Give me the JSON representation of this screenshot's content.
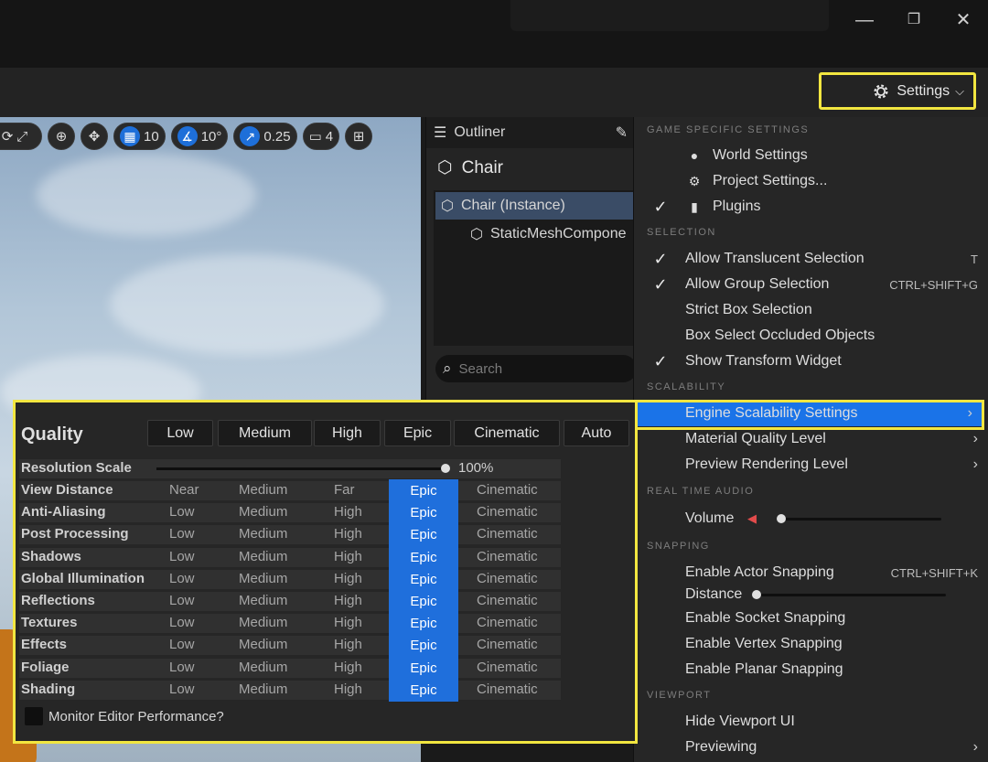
{
  "window": {
    "minimize": "—",
    "restore": "❐",
    "close": "✕"
  },
  "settings_button": {
    "label": "Settings",
    "icon": "gear-icon"
  },
  "viewport_toolbar": {
    "grid_value": "10",
    "angle_value": "10°",
    "scale_value": "0.25",
    "camera_value": "4"
  },
  "outliner": {
    "tab_label": "Outliner",
    "header": "Chair",
    "items": [
      {
        "label": "Chair (Instance)"
      },
      {
        "label": "StaticMeshCompone"
      }
    ],
    "search_placeholder": "Search"
  },
  "settings_menu": {
    "sections": {
      "game": "GAME SPECIFIC SETTINGS",
      "selection": "SELECTION",
      "scalability": "SCALABILITY",
      "audio": "REAL TIME AUDIO",
      "snapping": "SNAPPING",
      "viewport": "VIEWPORT"
    },
    "game": [
      {
        "label": "World Settings",
        "checked": false
      },
      {
        "label": "Project Settings...",
        "checked": false
      },
      {
        "label": "Plugins",
        "checked": true
      }
    ],
    "selection": [
      {
        "label": "Allow Translucent Selection",
        "checked": true,
        "shortcut": "T"
      },
      {
        "label": "Allow Group Selection",
        "checked": true,
        "shortcut": "CTRL+SHIFT+G"
      },
      {
        "label": "Strict Box Selection",
        "checked": false,
        "shortcut": ""
      },
      {
        "label": "Box Select Occluded Objects",
        "checked": false,
        "shortcut": ""
      },
      {
        "label": "Show Transform Widget",
        "checked": true,
        "shortcut": ""
      }
    ],
    "scalability": [
      {
        "label": "Engine Scalability Settings",
        "active": true
      },
      {
        "label": "Material Quality Level",
        "active": false
      },
      {
        "label": "Preview Rendering Level",
        "active": false
      }
    ],
    "audio": {
      "volume_label": "Volume",
      "volume_level": 0
    },
    "snapping": {
      "actor": "Enable Actor Snapping",
      "actor_shortcut": "CTRL+SHIFT+K",
      "distance": "Distance",
      "distance_level": 0,
      "socket": "Enable Socket Snapping",
      "vertex": "Enable Vertex Snapping",
      "planar": "Enable Planar Snapping"
    },
    "viewport": {
      "hide_ui": "Hide Viewport UI",
      "previewing": "Previewing"
    }
  },
  "scalability_panel": {
    "quality_label": "Quality",
    "quality_buttons": [
      "Low",
      "Medium",
      "High",
      "Epic",
      "Cinematic",
      "Auto"
    ],
    "resolution_label": "Resolution Scale",
    "resolution_value": "100%",
    "rows": [
      {
        "name": "View Distance",
        "levels": [
          "Near",
          "Medium",
          "Far",
          "Epic",
          "Cinematic"
        ],
        "selected": 3
      },
      {
        "name": "Anti-Aliasing",
        "levels": [
          "Low",
          "Medium",
          "High",
          "Epic",
          "Cinematic"
        ],
        "selected": 3
      },
      {
        "name": "Post Processing",
        "levels": [
          "Low",
          "Medium",
          "High",
          "Epic",
          "Cinematic"
        ],
        "selected": 3
      },
      {
        "name": "Shadows",
        "levels": [
          "Low",
          "Medium",
          "High",
          "Epic",
          "Cinematic"
        ],
        "selected": 3
      },
      {
        "name": "Global Illumination",
        "levels": [
          "Low",
          "Medium",
          "High",
          "Epic",
          "Cinematic"
        ],
        "selected": 3
      },
      {
        "name": "Reflections",
        "levels": [
          "Low",
          "Medium",
          "High",
          "Epic",
          "Cinematic"
        ],
        "selected": 3
      },
      {
        "name": "Textures",
        "levels": [
          "Low",
          "Medium",
          "High",
          "Epic",
          "Cinematic"
        ],
        "selected": 3
      },
      {
        "name": "Effects",
        "levels": [
          "Low",
          "Medium",
          "High",
          "Epic",
          "Cinematic"
        ],
        "selected": 3
      },
      {
        "name": "Foliage",
        "levels": [
          "Low",
          "Medium",
          "High",
          "Epic",
          "Cinematic"
        ],
        "selected": 3
      },
      {
        "name": "Shading",
        "levels": [
          "Low",
          "Medium",
          "High",
          "Epic",
          "Cinematic"
        ],
        "selected": 3
      }
    ],
    "monitor_label": "Monitor Editor Performance?"
  },
  "colors": {
    "accent": "#1a73e8",
    "highlight": "#f2e640"
  }
}
